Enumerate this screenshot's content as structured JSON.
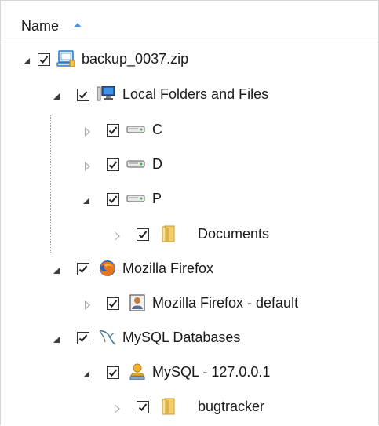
{
  "header": {
    "column_label": "Name",
    "sort_icon": "sort-ascending-icon"
  },
  "tree": [
    {
      "label": "backup_0037.zip",
      "icon": "archive-icon",
      "expanded": true,
      "checked": true
    },
    {
      "label": "Local Folders and Files",
      "icon": "computer-icon",
      "expanded": true,
      "checked": true
    },
    {
      "label": "C",
      "icon": "drive-icon",
      "expanded": false,
      "checked": true
    },
    {
      "label": "D",
      "icon": "drive-icon",
      "expanded": false,
      "checked": true
    },
    {
      "label": "P",
      "icon": "drive-icon",
      "expanded": true,
      "checked": true
    },
    {
      "label": "Documents",
      "icon": "folder-icon",
      "expanded": false,
      "checked": true
    },
    {
      "label": "Mozilla Firefox",
      "icon": "firefox-icon",
      "expanded": true,
      "checked": true
    },
    {
      "label": "Mozilla Firefox - default",
      "icon": "user-profile-icon",
      "expanded": false,
      "checked": true
    },
    {
      "label": "MySQL Databases",
      "icon": "mysql-icon",
      "expanded": true,
      "checked": true
    },
    {
      "label": "MySQL - 127.0.0.1",
      "icon": "database-server-icon",
      "expanded": true,
      "checked": true
    },
    {
      "label": "bugtracker",
      "icon": "folder-icon",
      "expanded": false,
      "checked": true
    }
  ]
}
